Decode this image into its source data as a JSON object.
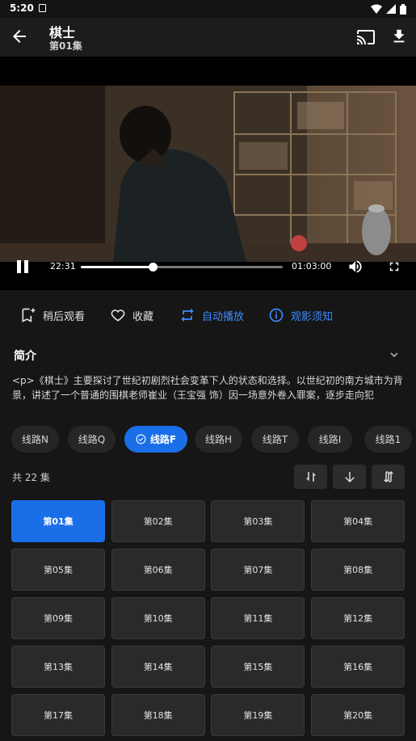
{
  "status": {
    "time": "5:20"
  },
  "header": {
    "title": "棋士",
    "subtitle": "第01集"
  },
  "player": {
    "current_time": "22:31",
    "duration": "01:03:00",
    "progress": 0.357
  },
  "actions": [
    {
      "label": "稍后观看",
      "icon": "bookmark-plus-icon",
      "highlight": false
    },
    {
      "label": "收藏",
      "icon": "heart-icon",
      "highlight": false
    },
    {
      "label": "自动播放",
      "icon": "repeat-icon",
      "highlight": true
    },
    {
      "label": "观影须知",
      "icon": "info-icon",
      "highlight": true
    }
  ],
  "intro": {
    "heading": "简介",
    "text": "<p>《棋士》主要探讨了世纪初剧烈社会变革下人的状态和选择。以世纪初的南方城市为背景，讲述了一个普通的围棋老师崔业（王宝强 饰）因一场意外卷入罪案，逐步走向犯"
  },
  "routes": [
    "线路N",
    "线路Q",
    "线路F",
    "线路H",
    "线路T",
    "线路I",
    "线路1"
  ],
  "active_route": 2,
  "episodes": {
    "count_label": "共 22 集",
    "items": [
      "第01集",
      "第02集",
      "第03集",
      "第04集",
      "第05集",
      "第06集",
      "第07集",
      "第08集",
      "第09集",
      "第10集",
      "第11集",
      "第12集",
      "第13集",
      "第14集",
      "第15集",
      "第16集",
      "第17集",
      "第18集",
      "第19集",
      "第20集"
    ],
    "active": 0
  },
  "colors": {
    "accent": "#1a6fe8",
    "accent_text": "#3d8bff",
    "background": "#161616"
  }
}
